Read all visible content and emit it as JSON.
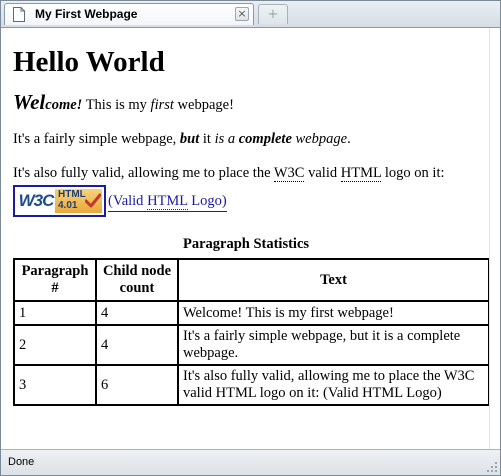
{
  "window": {
    "tab_title": "My First Webpage",
    "tab_close_glyph": "×",
    "new_tab_glyph": "+",
    "status": "Done"
  },
  "page": {
    "heading": "Hello World",
    "p1": {
      "welcome_initial": "Wel",
      "welcome_rest": "come!",
      "text_a": " This is my ",
      "first": "first",
      "text_b": " webpage!"
    },
    "p2": {
      "text_a": "It's a fairly simple webpage, ",
      "but": "but",
      "text_b": " it ",
      "is_a": "is a ",
      "complete": "complete",
      "webpage": " webpage",
      "period": "."
    },
    "p3": {
      "text_a": "It's also fully valid, allowing me to place the ",
      "w3c": "W3C",
      "text_b": " valid ",
      "html": "HTML",
      "text_c": " logo on it:"
    },
    "logo": {
      "badge_w3c": "W3C",
      "badge_line1": "HTML",
      "badge_line2": "4.01",
      "link_open": "(Valid ",
      "link_html": "HTML",
      "link_close": " Logo)",
      "check_color": "#c0392b"
    },
    "table": {
      "caption": "Paragraph Statistics",
      "headers": [
        "Paragraph #",
        "Child node count",
        "Text"
      ],
      "rows": [
        [
          "1",
          "4",
          "Welcome! This is my first webpage!"
        ],
        [
          "2",
          "4",
          "It's a fairly simple webpage, but it is a complete webpage."
        ],
        [
          "3",
          "6",
          "It's also fully valid, allowing me to place the W3C valid HTML logo on it: (Valid HTML Logo)"
        ]
      ]
    }
  },
  "colors": {
    "link": "#1a1aa6",
    "chrome_border": "#8c9aa8"
  }
}
